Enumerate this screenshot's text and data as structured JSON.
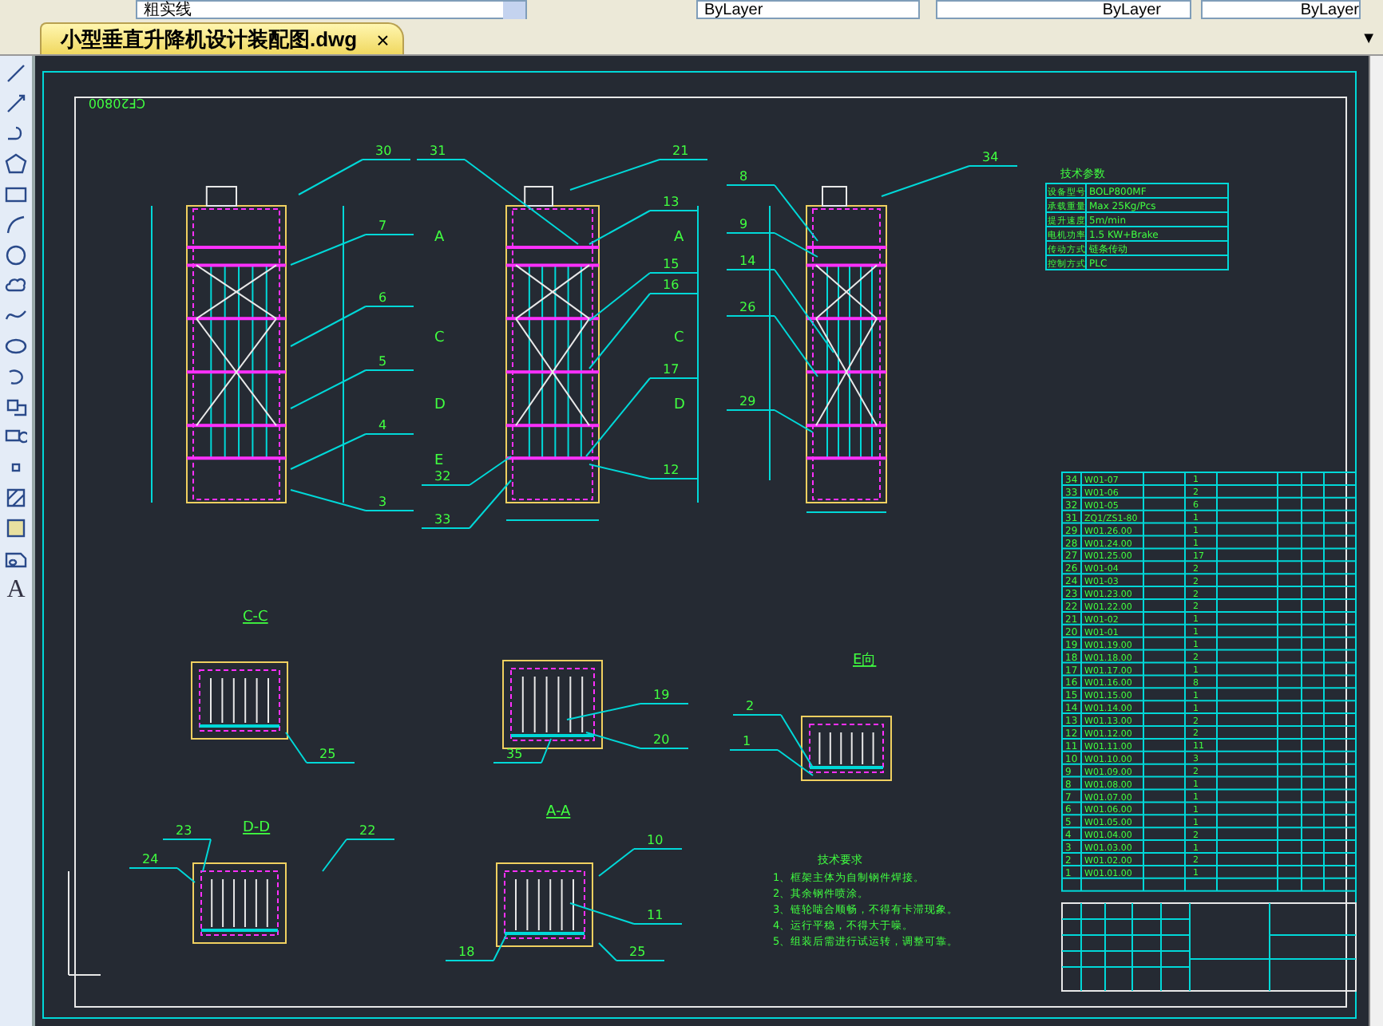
{
  "toolbar": {
    "layer": "粗实线",
    "color_setting": "ByLayer",
    "linetype": "ByLayer",
    "lineweight": "ByLayer"
  },
  "tabs": [
    {
      "label": "小型垂直升降机设计装配图.dwg",
      "selected": true,
      "close": "×"
    }
  ],
  "tab_menu": "▼",
  "text_tool": "A",
  "drawing": {
    "callouts": [
      "30",
      "7",
      "6",
      "5",
      "4",
      "3",
      "31",
      "21",
      "13",
      "15",
      "16",
      "17",
      "12",
      "32",
      "33",
      "34",
      "8",
      "9",
      "14",
      "26",
      "29",
      "19",
      "20",
      "35",
      "2",
      "1",
      "25",
      "23",
      "22",
      "24",
      "10",
      "11",
      "18",
      "25"
    ],
    "section_marks": [
      "A",
      "A",
      "C",
      "C",
      "D",
      "D",
      "E"
    ],
    "view_titles": [
      "C-C",
      "D-D",
      "A-A",
      "E向"
    ],
    "spec_title": "技术参数",
    "spec_rows": [
      {
        "label": "设备型号",
        "value": "BOLP800MF"
      },
      {
        "label": "承载重量",
        "value": "Max 25Kg/Pcs"
      },
      {
        "label": "提升速度",
        "value": "5m/min"
      },
      {
        "label": "电机功率",
        "value": "1.5 KW+Brake"
      },
      {
        "label": "传动方式",
        "value": "链条传动"
      },
      {
        "label": "控制方式",
        "value": "PLC"
      }
    ],
    "notes_title": "技术要求",
    "notes": [
      "1、框架主体为自制钢件焊接。",
      "2、其余钢件喷涂。",
      "3、链轮啮合顺畅，不得有卡滞现象。",
      "4、运行平稳，不得大于噪。",
      "5、组装后需进行试运转，调整可靠。"
    ],
    "parts": [
      {
        "no": "34",
        "code": "W01-07",
        "qty": "1"
      },
      {
        "no": "33",
        "code": "W01-06",
        "qty": "2"
      },
      {
        "no": "32",
        "code": "W01-05",
        "qty": "6"
      },
      {
        "no": "31",
        "code": "ZQ1/ZS1-80",
        "qty": "1"
      },
      {
        "no": "29",
        "code": "W01.26.00",
        "qty": "1"
      },
      {
        "no": "28",
        "code": "W01.24.00",
        "qty": "1"
      },
      {
        "no": "27",
        "code": "W01.25.00",
        "qty": "17"
      },
      {
        "no": "26",
        "code": "W01-04",
        "qty": "2"
      },
      {
        "no": "24",
        "code": "W01-03",
        "qty": "2"
      },
      {
        "no": "23",
        "code": "W01.23.00",
        "qty": "2"
      },
      {
        "no": "22",
        "code": "W01.22.00",
        "qty": "2"
      },
      {
        "no": "21",
        "code": "W01-02",
        "qty": "1"
      },
      {
        "no": "20",
        "code": "W01-01",
        "qty": "1"
      },
      {
        "no": "19",
        "code": "W01.19.00",
        "qty": "1"
      },
      {
        "no": "18",
        "code": "W01.18.00",
        "qty": "2"
      },
      {
        "no": "17",
        "code": "W01.17.00",
        "qty": "1"
      },
      {
        "no": "16",
        "code": "W01.16.00",
        "qty": "8"
      },
      {
        "no": "15",
        "code": "W01.15.00",
        "qty": "1"
      },
      {
        "no": "14",
        "code": "W01.14.00",
        "qty": "1"
      },
      {
        "no": "13",
        "code": "W01.13.00",
        "qty": "2"
      },
      {
        "no": "12",
        "code": "W01.12.00",
        "qty": "2"
      },
      {
        "no": "11",
        "code": "W01.11.00",
        "qty": "11"
      },
      {
        "no": "10",
        "code": "W01.10.00",
        "qty": "3"
      },
      {
        "no": "9",
        "code": "W01.09.00",
        "qty": "2"
      },
      {
        "no": "8",
        "code": "W01.08.00",
        "qty": "1"
      },
      {
        "no": "7",
        "code": "W01.07.00",
        "qty": "1"
      },
      {
        "no": "6",
        "code": "W01.06.00",
        "qty": "1"
      },
      {
        "no": "5",
        "code": "W01.05.00",
        "qty": "1"
      },
      {
        "no": "4",
        "code": "W01.04.00",
        "qty": "2"
      },
      {
        "no": "3",
        "code": "W01.03.00",
        "qty": "1"
      },
      {
        "no": "2",
        "code": "W01.02.00",
        "qty": "2"
      },
      {
        "no": "1",
        "code": "W01.01.00",
        "qty": "1"
      }
    ],
    "frame_code": "CF20800"
  }
}
